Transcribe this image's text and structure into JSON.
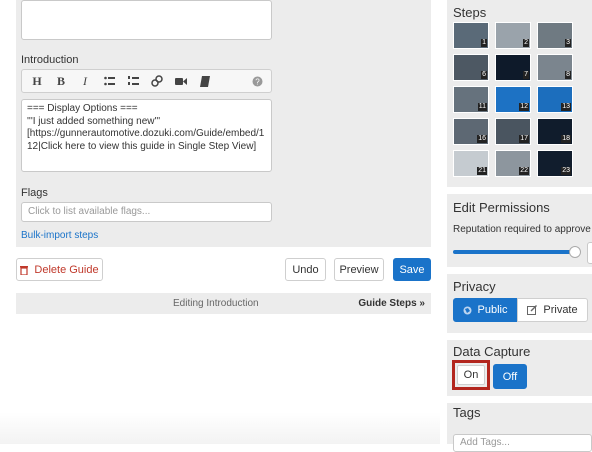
{
  "editor": {
    "intro_label": "Introduction",
    "intro_lines": [
      "=== Display Options ===",
      "'''I just added something new'''",
      "[https://gunnerautomotive.dozuki.com/Guide/embed/1",
      "12|Click here to view this guide in Single Step View]"
    ],
    "toolbar": [
      "H",
      "B",
      "I",
      "bulleted-list-icon",
      "numbered-list-icon",
      "link-icon",
      "video-icon",
      "book-icon",
      "help-icon"
    ],
    "flags_label": "Flags",
    "flags_placeholder": "Click to list available flags...",
    "bulk_import": "Bulk-import steps"
  },
  "actions": {
    "delete": "Delete Guide",
    "undo": "Undo",
    "preview": "Preview",
    "save": "Save"
  },
  "status_bar": {
    "editing": "Editing Introduction",
    "guide_steps": "Guide Steps »"
  },
  "sidebar": {
    "steps_title": "Steps",
    "steps": [
      {
        "n": "1",
        "c": "#5a6a78"
      },
      {
        "n": "2",
        "c": "#9aa3ab"
      },
      {
        "n": "3",
        "c": "#6f7a82"
      },
      {
        "n": "6",
        "c": "#4d5863"
      },
      {
        "n": "7",
        "c": "#0e1a2a"
      },
      {
        "n": "8",
        "c": "#7b858e"
      },
      {
        "n": "11",
        "c": "#66727d"
      },
      {
        "n": "12",
        "c": "#1d72c4"
      },
      {
        "n": "13",
        "c": "#1c6ebd"
      },
      {
        "n": "16",
        "c": "#5d6873"
      },
      {
        "n": "17",
        "c": "#4a5560"
      },
      {
        "n": "18",
        "c": "#101c2c"
      },
      {
        "n": "21",
        "c": "#c5cbd0"
      },
      {
        "n": "22",
        "c": "#8d969e"
      },
      {
        "n": "23",
        "c": "#111d2d"
      }
    ],
    "permissions_title": "Edit Permissions",
    "permissions_text": "Reputation required to approve e",
    "privacy_title": "Privacy",
    "public": "Public",
    "private": "Private",
    "data_capture_title": "Data Capture",
    "on": "On",
    "off": "Off",
    "tags_title": "Tags",
    "tags_placeholder": "Add Tags..."
  },
  "colors": {
    "accent": "#1a73c9",
    "highlight": "#b3261e",
    "panel": "#ececec"
  }
}
